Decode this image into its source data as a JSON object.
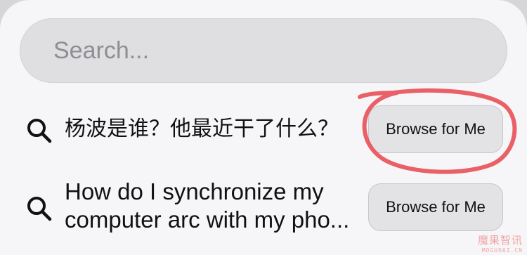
{
  "search": {
    "placeholder": "Search...",
    "value": ""
  },
  "suggestions": [
    {
      "icon": "magnifying-glass-icon",
      "text": "杨波是谁？他最近干了什么？",
      "button_label": "Browse for Me"
    },
    {
      "icon": "magnifying-glass-icon",
      "text_lines": [
        "How do I synchronize my",
        "computer arc with my pho..."
      ],
      "button_label": "Browse for Me"
    }
  ],
  "annotation": {
    "shape": "hand-drawn-circle",
    "target": "first Browse for Me button",
    "color": "#e8525a"
  },
  "watermark": {
    "text_cn": "魔果智讯",
    "text_en": "MOGUOAI.CN"
  },
  "colors": {
    "panel_background": "#f6f6f8",
    "search_field": "#dfdfe2",
    "button_background": "#e3e3e6",
    "placeholder": "#8e8e93",
    "annotation": "#e8525a"
  }
}
